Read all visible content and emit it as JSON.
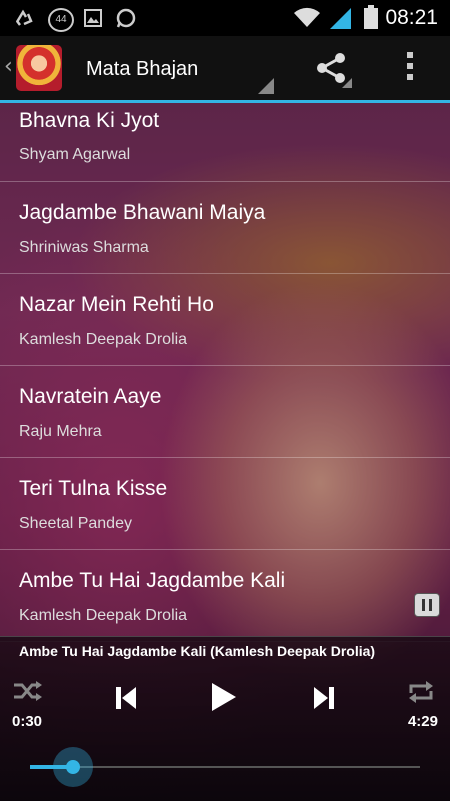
{
  "status_bar": {
    "time": "08:21",
    "badge": "44",
    "icons": [
      "recycle-icon",
      "badge-icon",
      "image-icon",
      "whatsapp-icon",
      "wifi-icon",
      "signal-icon",
      "battery-icon"
    ]
  },
  "action_bar": {
    "title": "Mata Bhajan",
    "icons": [
      "up-caret-icon",
      "app-icon",
      "share-icon",
      "overflow-menu-icon"
    ]
  },
  "songs": [
    {
      "title": "Bhavna Ki Jyot",
      "artist": "Shyam Agarwal"
    },
    {
      "title": "Jagdambe Bhawani Maiya",
      "artist": "Shriniwas Sharma"
    },
    {
      "title": "Nazar Mein Rehti Ho",
      "artist": "Kamlesh Deepak Drolia"
    },
    {
      "title": "Navratein Aaye",
      "artist": "Raju Mehra"
    },
    {
      "title": "Teri Tulna Kisse",
      "artist": "Sheetal Pandey"
    },
    {
      "title": "Ambe Tu Hai Jagdambe Kali",
      "artist": "Kamlesh Deepak Drolia"
    }
  ],
  "player": {
    "now_playing": "Ambe Tu Hai Jagdambe Kali (Kamlesh Deepak Drolia)",
    "elapsed": "0:30",
    "duration": "4:29",
    "progress": 0.11
  },
  "colors": {
    "accent": "#33b5e5"
  }
}
